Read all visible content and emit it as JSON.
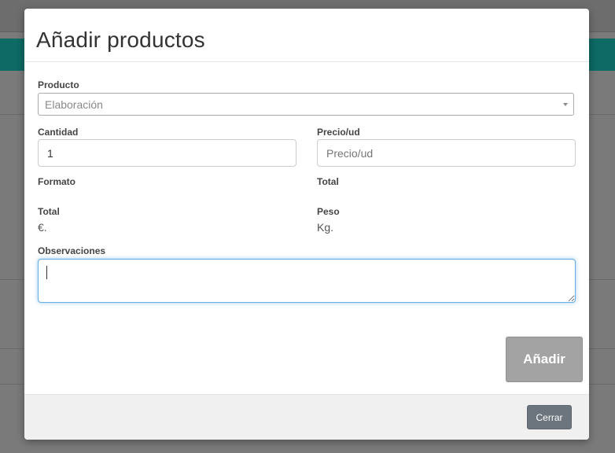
{
  "modal": {
    "title": "Añadir productos"
  },
  "form": {
    "producto": {
      "label": "Producto",
      "selected": "Elaboración"
    },
    "cantidad": {
      "label": "Cantidad",
      "value": "1"
    },
    "precio": {
      "label": "Precio/ud",
      "placeholder": "Precio/ud",
      "value": ""
    },
    "formato": {
      "label": "Formato",
      "value": ""
    },
    "total_right": {
      "label": "Total",
      "value": ""
    },
    "total": {
      "label": "Total",
      "value": "€."
    },
    "peso": {
      "label": "Peso",
      "value": "Kg."
    },
    "observaciones": {
      "label": "Observaciones",
      "value": ""
    },
    "add_label": "Añadir"
  },
  "footer": {
    "close_label": "Cerrar"
  },
  "colors": {
    "accent_focus": "#66afe9",
    "background_teal": "#0d6a64",
    "add_button": "#a3a3a3",
    "close_button": "#6c757d"
  }
}
